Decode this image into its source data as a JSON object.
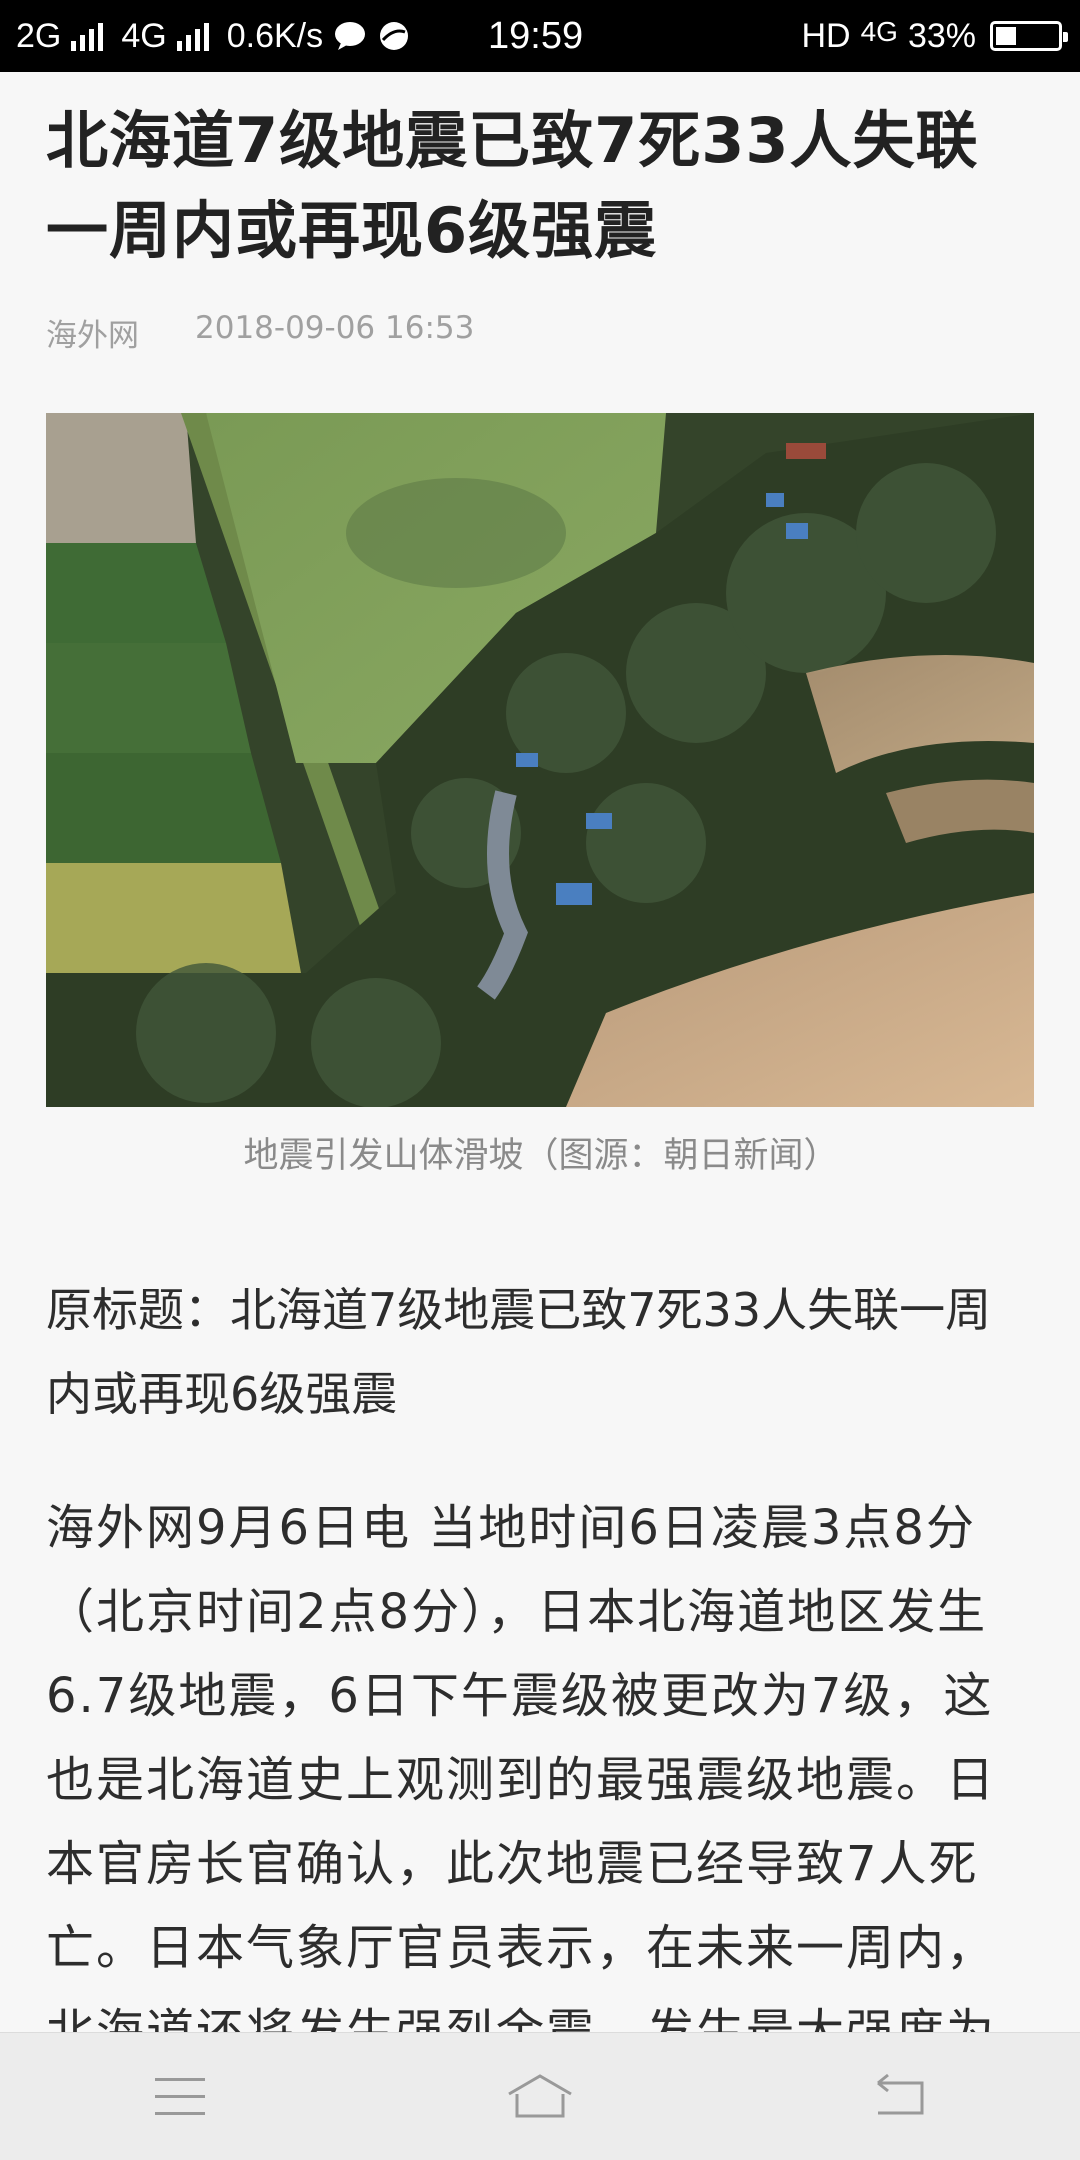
{
  "status_bar": {
    "network_2g": "2G",
    "network_4g": "4G",
    "speed": "0.6K/s",
    "time": "19:59",
    "hd_label": "HD",
    "lte_label": "4G",
    "battery_text": "33%",
    "battery_level": 0.33
  },
  "article": {
    "title": "北海道7级地震已致7死33人失联一周内或再现6级强震",
    "source": "海外网",
    "timestamp": "2018-09-06 16:53",
    "image_caption": "地震引发山体滑坡（图源：朝日新闻）",
    "original_title": "原标题：北海道7级地震已致7死33人失联一周内或再现6级强震",
    "body": "海外网9月6日电 当地时间6日凌晨3点8分（北京时间2点8分），日本北海道地区发生6.7级地震，6日下午震级被更改为7级，这也是北海道史上观测到的最强震级地震。日本官房长官确认，此次地震已经导致7人死亡。日本气象厅官员表示，在未来一周内，北海道还将发生强烈余震，发生最大强度为"
  },
  "icons": {
    "message": "message-icon",
    "app": "app-icon",
    "menu": "menu-icon",
    "home": "home-icon",
    "back": "back-icon"
  }
}
